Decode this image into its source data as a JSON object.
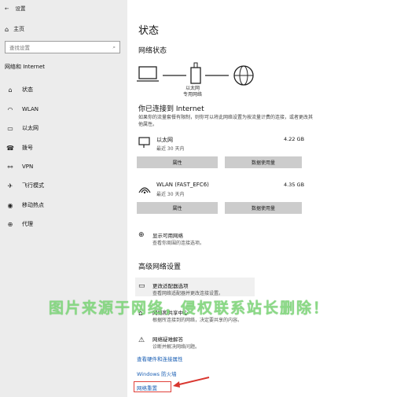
{
  "window": {
    "title": "设置"
  },
  "sidebar": {
    "home_label": "主页",
    "search_placeholder": "查找设置",
    "group_label": "网络和 Internet",
    "items": [
      {
        "label": "状态",
        "icon": "home-icon"
      },
      {
        "label": "WLAN",
        "icon": "wifi-icon"
      },
      {
        "label": "以太网",
        "icon": "ethernet-icon"
      },
      {
        "label": "拨号",
        "icon": "phone-icon"
      },
      {
        "label": "VPN",
        "icon": "vpn-icon"
      },
      {
        "label": "飞行模式",
        "icon": "airplane-icon"
      },
      {
        "label": "移动热点",
        "icon": "hotspot-icon"
      },
      {
        "label": "代理",
        "icon": "globe-icon"
      }
    ]
  },
  "main": {
    "title": "状态",
    "network_status_title": "网络状态",
    "diagram_label_line1": "以太网",
    "diagram_label_line2": "专用网络",
    "connected_title": "你已连接到 Internet",
    "connected_desc": "如果你的流量套餐有限制，则你可以将此网络设置为按流量计费的连接，或者更改其他属性。",
    "ethernet": {
      "name": "以太网",
      "sub": "最近 30 天内",
      "usage": "4.22 GB",
      "btn_properties": "属性",
      "btn_usage": "数据使用量"
    },
    "wlan": {
      "name": "WLAN (FAST_EFC6)",
      "sub": "最近 30 天内",
      "usage": "4.35 GB",
      "btn_properties": "属性",
      "btn_usage": "数据使用量"
    },
    "show_available": "显示可用网络",
    "show_available_sub": "查看你周围的连接选项。",
    "advanced_title": "高级网络设置",
    "adapter_title": "更改适配器选项",
    "adapter_sub": "查看网络适配器并更改连接设置。",
    "sharing_title": "网络和共享中心",
    "sharing_sub": "根据所连接到的网络，决定要共享的内容。",
    "troubleshoot_title": "网络疑难解答",
    "troubleshoot_sub": "诊断并解决网络问题。",
    "hardware_link": "查看硬件和连接属性",
    "firewall_link": "Windows 防火墙",
    "reset_link": "网络重置"
  },
  "overlay": {
    "watermark": "图片来源于网络，侵权联系站长删除！"
  }
}
